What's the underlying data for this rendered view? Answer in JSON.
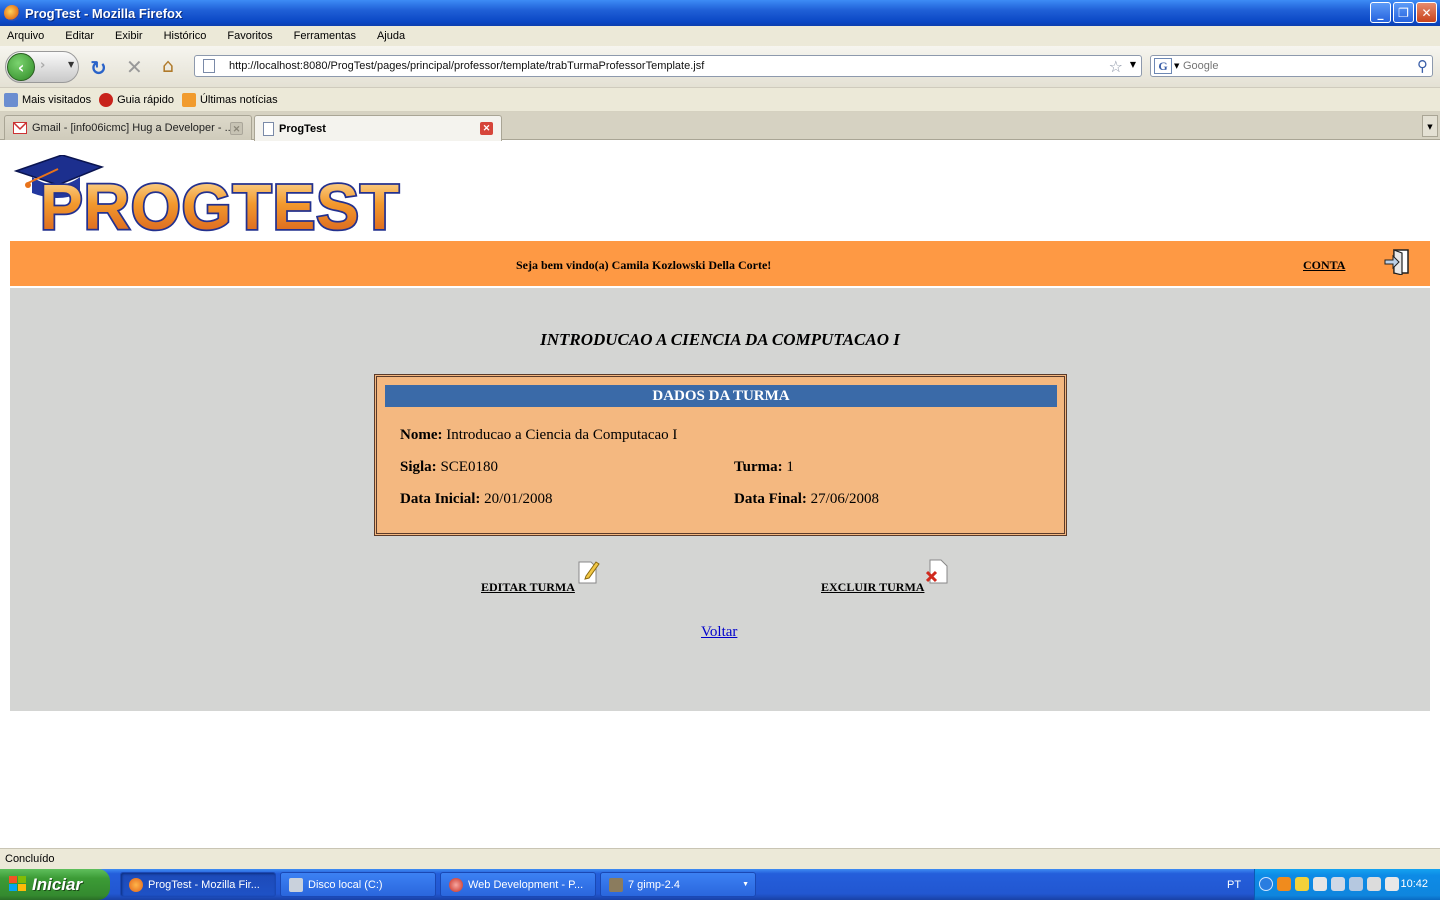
{
  "window": {
    "title": "ProgTest - Mozilla Firefox",
    "buttons": [
      "_",
      "❐",
      "✕"
    ]
  },
  "menu": [
    "Arquivo",
    "Editar",
    "Exibir",
    "Histórico",
    "Favoritos",
    "Ferramentas",
    "Ajuda"
  ],
  "nav": {
    "url": "http://localhost:8080/ProgTest/pages/principal/professor/template/trabTurmaProfessorTemplate.jsf",
    "search_placeholder": "Google"
  },
  "bookmarks": [
    {
      "label": "Mais visitados",
      "icon": "bookmark-folder-icon"
    },
    {
      "label": "Guia rápido",
      "icon": "red-panda-icon"
    },
    {
      "label": "Últimas notícias",
      "icon": "rss-feed-icon"
    }
  ],
  "tabs": [
    {
      "label": "Gmail - [info06icmc] Hug a Developer - ...",
      "active": false
    },
    {
      "label": "ProgTest",
      "active": true
    }
  ],
  "page": {
    "logo_text": "PROGTEST",
    "welcome": "Seja bem vindo(a) Camila Kozlowski Della Corte!",
    "account_link": "CONTA",
    "course_title": "INTRODUCAO A CIENCIA DA COMPUTACAO I",
    "panel": {
      "heading": "DADOS DA TURMA",
      "nome_label": "Nome:",
      "nome_value": "Introducao a Ciencia da Computacao I",
      "sigla_label": "Sigla:",
      "sigla_value": "SCE0180",
      "turma_label": "Turma:",
      "turma_value": "1",
      "data_inicial_label": "Data Inicial:",
      "data_inicial_value": "20/01/2008",
      "data_final_label": "Data Final:",
      "data_final_value": "27/06/2008"
    },
    "edit_link": "EDITAR TURMA",
    "delete_link": "EXCLUIR TURMA",
    "back_link": "Voltar"
  },
  "status": "Concluído",
  "taskbar": {
    "start_label": "Iniciar",
    "tasks": [
      {
        "label": "ProgTest - Mozilla Fir...",
        "active": true
      },
      {
        "label": "Disco local (C:)",
        "active": false
      },
      {
        "label": "Web Development - P...",
        "active": false
      },
      {
        "label": "7 gimp-2.4",
        "active": false
      }
    ],
    "language": "PT",
    "clock": "10:42"
  },
  "colors": {
    "welcome_bar": "#fe9944",
    "content_bg": "#d4d5d3",
    "panel_bg": "#f4b880",
    "panel_header": "#3a6aa8",
    "link": "#0000cc"
  }
}
